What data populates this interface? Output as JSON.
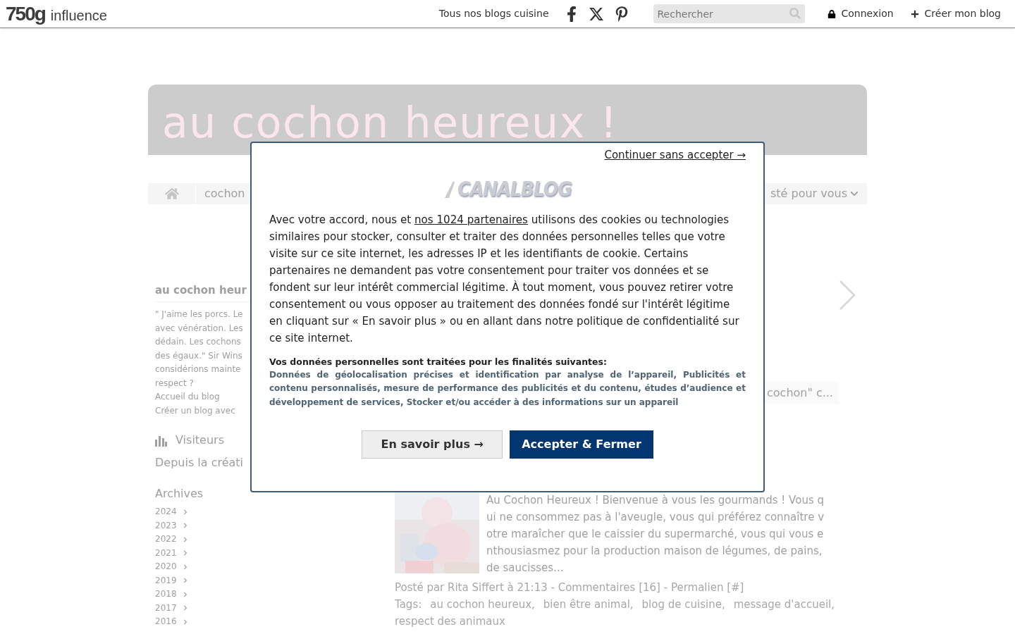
{
  "topbar": {
    "logo_number": "750g",
    "logo_word": "influence",
    "blogs_link": "Tous nos blogs cuisine",
    "search": {
      "placeholder": "Rechercher"
    },
    "login": "Connexion",
    "create": "Créer mon blog"
  },
  "banner": {
    "title": "au cochon heureux !"
  },
  "nav": {
    "items": [
      {
        "label": "cochon",
        "kind": "plain"
      },
      {
        "label": "sté pour vous",
        "kind": "dropdown"
      }
    ]
  },
  "sidebar": {
    "title": "au cochon heur",
    "quote_lines": [
      "\" J'aime les porcs. Le",
      "avec vénération. Les",
      "dédain. Les cochons",
      "des égaux.\" Sir Wins",
      "considérions mainte",
      "respect ?"
    ],
    "links": [
      "Accueil du blog",
      "Créer un blog avec"
    ],
    "visitors_title": "Visiteurs",
    "visitors_text": "Depuis la créati",
    "archives_title": "Archives",
    "years": [
      "2024",
      "2023",
      "2022",
      "2021",
      "2020",
      "2019",
      "2018",
      "2017",
      "2016"
    ]
  },
  "content": {
    "tag": "cochon\" c...",
    "article": {
      "kind": "picture",
      "lines": [
        "Au Cochon Heureux ! Bienvenue à vous les gourmands ! Vous q",
        "ui ne consommez pas à l'aveugle, vous qui préférez connaître v",
        "otre maraîcher que le caissier du supermarché, vous qui vous e",
        "nthousiasmez pour la production maison de légumes, de pains,",
        "de saucisses..."
      ]
    },
    "meta": "Posté par Rita Siffert à 21:13 - Commentaires [16] - Permalien [#]",
    "tags_label": "Tags:",
    "tags": [
      "au cochon heureux,",
      "bien être animal,",
      "blog de cuisine,",
      "message d'accueil,",
      "respect des animaux"
    ]
  },
  "consent": {
    "skip_link": "Continuer sans accepter →",
    "logo": "CANALBLOG",
    "text_before": "Avec votre accord, nous et ",
    "partners_link": "nos 1024 partenaires",
    "text_after": " utilisons des cookies ou technologies similaires pour stocker, consulter et traiter des données personnelles telles que votre visite sur ce site internet, les adresses IP et les identifiants de cookie. Certains partenaires ne demandent pas votre consentement pour traiter vos données et se fondent sur leur intérêt commercial légitime. À tout moment, vous pouvez retirer votre consentement ou vous opposer au traitement des données fondé sur l'intérêt légitime en cliquant sur « En savoir plus » ou en allant dans notre politique de confidentialité sur ce site internet.",
    "purposes_title": "Vos données personnelles sont traitées pour les finalités suivantes:",
    "purposes": "Données de géolocalisation précises et identification par analyse de l’appareil, Publicités et contenu personnalisés, mesure de performance des publicités et du contenu, études d’audience et développement de services, Stocker et/ou accéder à des informations sur un appareil",
    "buttons": [
      {
        "label": "En savoir plus →",
        "kind": "secondary"
      },
      {
        "label": "Accepter & Fermer",
        "kind": "primary"
      }
    ]
  }
}
